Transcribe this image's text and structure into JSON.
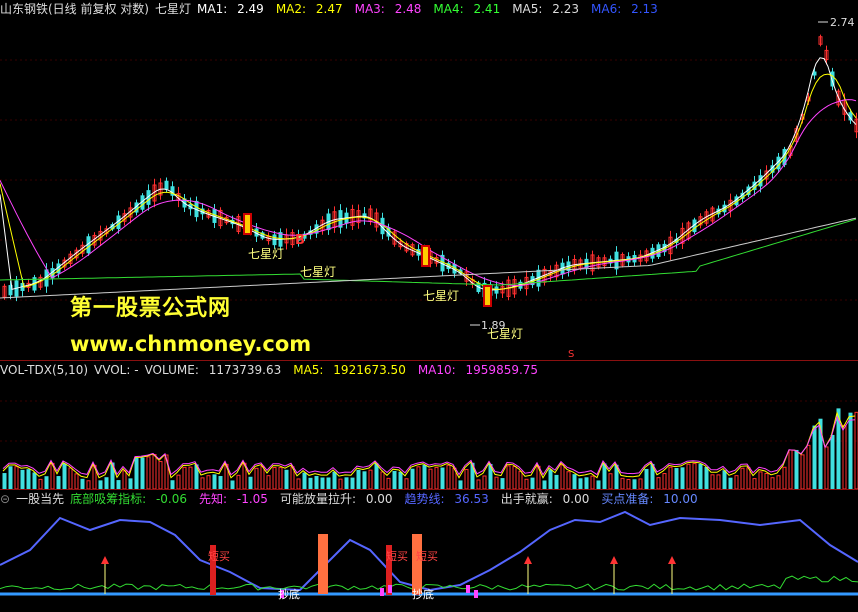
{
  "price_pane": {
    "stock": "山东钢铁(日线 前复权 对数)",
    "indicator": "七星灯",
    "ma": [
      {
        "label": "MA1:",
        "value": "2.49",
        "color": "#ffffff"
      },
      {
        "label": "MA2:",
        "value": "2.47",
        "color": "#ffff00"
      },
      {
        "label": "MA3:",
        "value": "2.48",
        "color": "#ff44ff"
      },
      {
        "label": "MA4:",
        "value": "2.41",
        "color": "#33ff33"
      },
      {
        "label": "MA5:",
        "value": "2.23",
        "color": "#dddddd"
      },
      {
        "label": "MA6:",
        "value": "2.13",
        "color": "#3355ff"
      }
    ],
    "high_label": "2.74",
    "low_label": "1.89",
    "signal_labels": [
      "七星灯",
      "七星灯",
      "七星灯",
      "七星灯"
    ],
    "b_marker": "B",
    "s_marker": "S",
    "watermark_cn": "第一股票公式网",
    "watermark_url": "www.chnmoney.com"
  },
  "volume_pane": {
    "name": "VOL-TDX(5,10)",
    "vvol": "VVOL: -",
    "volume": {
      "label": "VOLUME:",
      "value": "1173739.63"
    },
    "ma5": {
      "label": "MA5:",
      "value": "1921673.50"
    },
    "ma10": {
      "label": "MA10:",
      "value": "1959859.75"
    }
  },
  "indicator_pane": {
    "name": "一股当先",
    "items": [
      {
        "label": "底部吸筹指标:",
        "value": "-0.06",
        "color": "#33dd33"
      },
      {
        "label": "先知:",
        "value": "-1.05",
        "color": "#ff44ff"
      },
      {
        "label": "可能放量拉升:",
        "value": "0.00",
        "color": "#dddddd"
      },
      {
        "label": "趋势线:",
        "value": "36.53",
        "color": "#5566ff"
      },
      {
        "label": "出手就赢:",
        "value": "0.00",
        "color": "#dddddd"
      },
      {
        "label": "买点准备:",
        "value": "10.00",
        "color": "#6688ff"
      }
    ],
    "tags": [
      "短买",
      "短买",
      "短买",
      "抄底",
      "抄底"
    ]
  }
}
